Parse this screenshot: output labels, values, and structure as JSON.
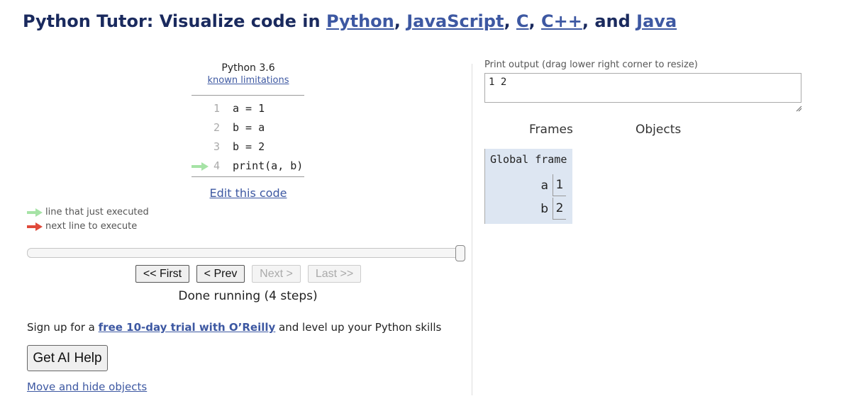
{
  "header": {
    "prefix": "Python Tutor: Visualize code in ",
    "lang_links": [
      "Python",
      "JavaScript",
      "C",
      "C++",
      "Java"
    ],
    "sep1": ", ",
    "sep2": ", ",
    "sep3": ", ",
    "sep4": ", and "
  },
  "code_panel": {
    "language": "Python 3.6",
    "limitations_link": "known limitations",
    "lines": [
      {
        "num": "1",
        "code": "a = 1"
      },
      {
        "num": "2",
        "code": "b = a"
      },
      {
        "num": "3",
        "code": "b = 2"
      },
      {
        "num": "4",
        "code": "print(a, b)"
      }
    ],
    "current_line": 4,
    "edit_link": "Edit this code"
  },
  "legend": {
    "executed": "line that just executed",
    "next": "next line to execute",
    "executed_color": "#a6e3a6",
    "next_color": "#e04a3a"
  },
  "controls": {
    "first": "<< First",
    "prev": "< Prev",
    "next": "Next >",
    "last": "Last >>",
    "status": "Done running (4 steps)",
    "slider_progress": 1.0
  },
  "promo": {
    "before": "Sign up for a ",
    "link": "free 10-day trial with O’Reilly",
    "after": " and level up your Python skills"
  },
  "ai_button": "Get AI Help",
  "hide_link": "Move and hide objects",
  "output": {
    "label": "Print output (drag lower right corner to resize)",
    "text": "1 2"
  },
  "viz": {
    "frames_header": "Frames",
    "objects_header": "Objects",
    "frame_title": "Global frame",
    "vars": [
      {
        "name": "a",
        "value": "1"
      },
      {
        "name": "b",
        "value": "2"
      }
    ]
  },
  "colors": {
    "accent": "#3d58a2",
    "header": "#1a2a5e",
    "frame_bg": "#dde6f2"
  }
}
